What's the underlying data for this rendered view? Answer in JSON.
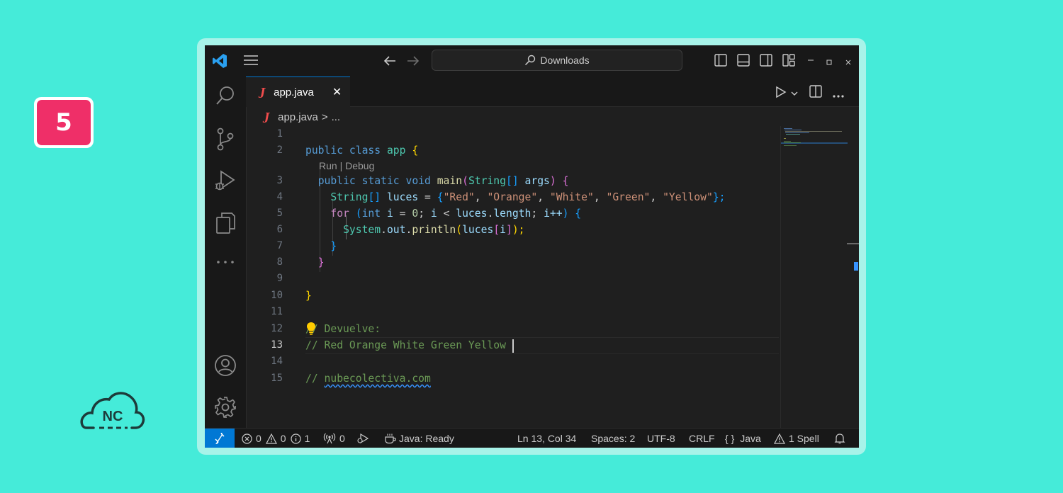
{
  "badge": {
    "number": "5"
  },
  "logo": {
    "text": "NC"
  },
  "titlebar": {
    "search_text": "Downloads"
  },
  "tab": {
    "filename": "app.java",
    "close": "✕"
  },
  "breadcrumb": {
    "file": "app.java",
    "sep": ">",
    "more": "..."
  },
  "codelens": {
    "text": "Run | Debug"
  },
  "lines": [
    "1",
    "2",
    "3",
    "4",
    "5",
    "6",
    "7",
    "8",
    "9",
    "10",
    "11",
    "12",
    "13",
    "14",
    "15"
  ],
  "current_line": "13",
  "code": {
    "l2": [
      "public",
      "class",
      "app",
      "{"
    ],
    "l3": [
      "public",
      "static",
      "void",
      "main",
      "(",
      "String",
      "[]",
      "args",
      ")",
      "{"
    ],
    "l4": [
      "String",
      "[]",
      "luces",
      "=",
      "{",
      "\"Red\"",
      "\"Orange\"",
      "\"White\"",
      "\"Green\"",
      "\"Yellow\"",
      "};"
    ],
    "l5": [
      "for",
      "(",
      "int",
      "i",
      "=",
      "0",
      ";",
      "i",
      "<",
      "luces",
      ".",
      "length",
      ";",
      "i++",
      ")",
      "{"
    ],
    "l6": [
      "System",
      ".",
      "out",
      ".",
      "println",
      "(",
      "luces",
      "[",
      "i",
      "]",
      ");"
    ],
    "l7": "}",
    "l8": "}",
    "l10": "}",
    "l12": "// Devuelve:",
    "l13": "// Red Orange White Green Yellow",
    "l15_prefix": "// ",
    "l15_link": "nubecolectiva.com"
  },
  "status": {
    "errors": "0",
    "warnings": "0",
    "infos": "1",
    "ports": "0",
    "java": "Java: Ready",
    "position": "Ln 13, Col 34",
    "spaces": "Spaces: 2",
    "encoding": "UTF-8",
    "eol": "CRLF",
    "language": "Java",
    "language_icon": "{ }",
    "spell": "1 Spell"
  },
  "colors": {
    "accent": "#0078d4",
    "background": "#45ebd9",
    "badge": "#ef2f68"
  }
}
